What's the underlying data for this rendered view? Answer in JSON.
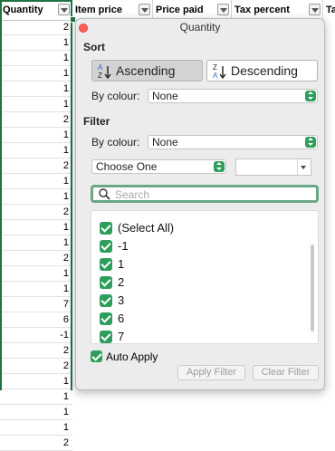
{
  "sheet": {
    "headers": [
      "Quantity",
      "Item price",
      "Price paid",
      "Tax percent",
      "Ta"
    ],
    "quantity_values": [
      "2",
      "1",
      "1",
      "1",
      "1",
      "1",
      "2",
      "1",
      "1",
      "2",
      "1",
      "1",
      "2",
      "1",
      "1",
      "2",
      "1",
      "1",
      "7",
      "6",
      "-1",
      "2",
      "2",
      "1",
      "1",
      "1",
      "1",
      "2"
    ]
  },
  "popover": {
    "title": "Quantity",
    "sort": {
      "heading": "Sort",
      "ascending_label": "Ascending",
      "descending_label": "Descending",
      "by_colour_label": "By colour:",
      "by_colour_value": "None"
    },
    "filter": {
      "heading": "Filter",
      "by_colour_label": "By colour:",
      "by_colour_value": "None",
      "condition_value": "Choose One",
      "condition_input_value": "",
      "search_placeholder": "Search",
      "items": [
        {
          "label": "(Select All)",
          "checked": true
        },
        {
          "label": "-1",
          "checked": true
        },
        {
          "label": "1",
          "checked": true
        },
        {
          "label": "2",
          "checked": true
        },
        {
          "label": "3",
          "checked": true
        },
        {
          "label": "6",
          "checked": true
        },
        {
          "label": "7",
          "checked": true
        }
      ],
      "auto_apply_label": "Auto Apply",
      "auto_apply_checked": true,
      "apply_filter_label": "Apply Filter",
      "clear_filter_label": "Clear Filter"
    }
  },
  "colors": {
    "accent": "#2e9e5c",
    "selection": "#1f7244",
    "close": "#ff5f57"
  }
}
